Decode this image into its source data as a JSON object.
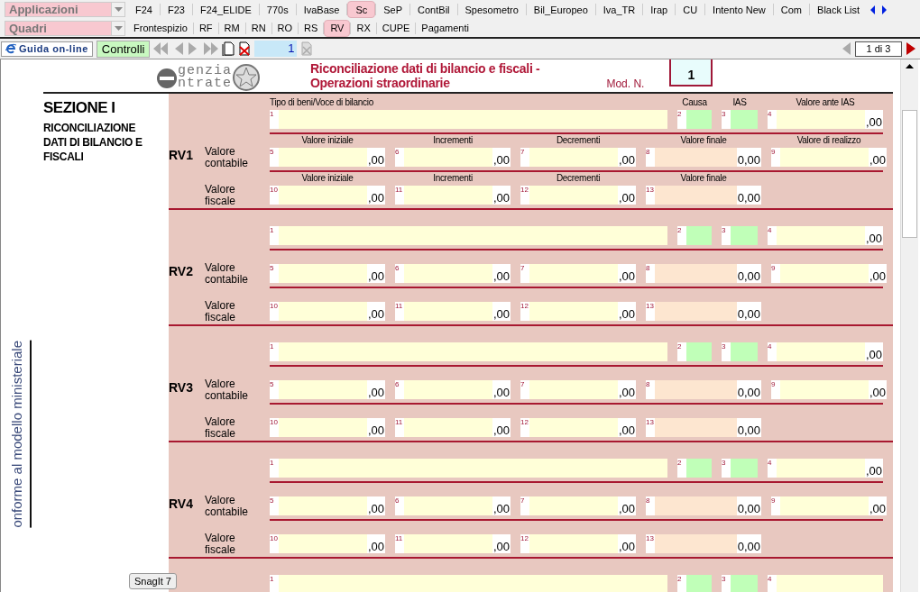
{
  "apps_dropdown": {
    "value": "Applicazioni"
  },
  "quadri_dropdown": {
    "value": "Quadri"
  },
  "app_tabs": [
    {
      "label": "F24",
      "selected": false
    },
    {
      "label": "F23",
      "selected": false
    },
    {
      "label": "F24_ELIDE",
      "selected": false
    },
    {
      "label": "770s",
      "selected": false
    },
    {
      "label": "IvaBase",
      "selected": false
    },
    {
      "label": "Sc",
      "selected": true
    },
    {
      "label": "SeP",
      "selected": false
    },
    {
      "label": "ContBil",
      "selected": false
    },
    {
      "label": "Spesometro",
      "selected": false
    },
    {
      "label": "Bil_Europeo",
      "selected": false
    },
    {
      "label": "Iva_TR",
      "selected": false
    },
    {
      "label": "Irap",
      "selected": false
    },
    {
      "label": "CU",
      "selected": false
    },
    {
      "label": "Intento New",
      "selected": false
    },
    {
      "label": "Com",
      "selected": false
    },
    {
      "label": "Black List",
      "selected": false
    }
  ],
  "quadri_tabs": [
    {
      "label": "Frontespizio",
      "selected": false
    },
    {
      "label": "RF",
      "selected": false
    },
    {
      "label": "RM",
      "selected": false
    },
    {
      "label": "RN",
      "selected": false
    },
    {
      "label": "RO",
      "selected": false
    },
    {
      "label": "RS",
      "selected": false
    },
    {
      "label": "RV",
      "selected": true
    },
    {
      "label": "RX",
      "selected": false
    },
    {
      "label": "CUPE",
      "selected": false
    },
    {
      "label": "Pagamenti",
      "selected": false
    }
  ],
  "toolbar": {
    "guide_button": "Guida on-line",
    "checks_button": "Controlli",
    "page_field": "1",
    "page_counter": "1 di 3"
  },
  "form": {
    "logo_top": "genzia",
    "logo_bottom": "ntrate",
    "title_lines": [
      "Riconciliazione dati di bilancio e fiscali -",
      "Operazioni straordinarie"
    ],
    "mod_label": "Mod. N.",
    "mod_number": "1",
    "section_title": "SEZIONE I",
    "section_subtitle": "RICONCILIAZIONE DATI DI BILANCIO E FISCALI",
    "side_note": "onforme al modello ministeriale",
    "blocks": [
      {
        "code": "RV1",
        "rows": [
          {
            "fields": [
              {
                "num": "1",
                "kind": "text",
                "header": "Tipo di beni/Voce di bilancio"
              },
              {
                "num": "2",
                "kind": "code",
                "header": "Causa"
              },
              {
                "num": "3",
                "kind": "code",
                "header": "IAS"
              },
              {
                "num": "4",
                "kind": "amount",
                "value": ",00",
                "header": "Valore ante IAS"
              }
            ]
          },
          {
            "label": "Valore contabile",
            "fields": [
              {
                "num": "5",
                "kind": "amount",
                "value": ",00",
                "header": "Valore iniziale"
              },
              {
                "num": "6",
                "kind": "amount",
                "value": ",00",
                "header": "Incrementi"
              },
              {
                "num": "7",
                "kind": "amount",
                "value": ",00",
                "header": "Decrementi"
              },
              {
                "num": "8",
                "kind": "computed",
                "value": "0,00",
                "header": "Valore finale"
              },
              {
                "num": "9",
                "kind": "amount",
                "value": ",00",
                "header": "Valore di realizzo"
              }
            ]
          },
          {
            "label": "Valore fiscale",
            "fields": [
              {
                "num": "10",
                "kind": "amount",
                "value": ",00",
                "header": "Valore iniziale"
              },
              {
                "num": "11",
                "kind": "amount",
                "value": ",00",
                "header": "Incrementi"
              },
              {
                "num": "12",
                "kind": "amount",
                "value": ",00",
                "header": "Decrementi"
              },
              {
                "num": "13",
                "kind": "computed",
                "value": "0,00",
                "header": "Valore finale"
              }
            ]
          }
        ]
      },
      {
        "code": "RV2",
        "rows": [
          {
            "fields": [
              {
                "num": "1",
                "kind": "text"
              },
              {
                "num": "2",
                "kind": "code"
              },
              {
                "num": "3",
                "kind": "code"
              },
              {
                "num": "4",
                "kind": "amount",
                "value": ",00"
              }
            ]
          },
          {
            "label": "Valore contabile",
            "fields": [
              {
                "num": "5",
                "kind": "amount",
                "value": ",00"
              },
              {
                "num": "6",
                "kind": "amount",
                "value": ",00"
              },
              {
                "num": "7",
                "kind": "amount",
                "value": ",00"
              },
              {
                "num": "8",
                "kind": "computed",
                "value": "0,00"
              },
              {
                "num": "9",
                "kind": "amount",
                "value": ",00"
              }
            ]
          },
          {
            "label": "Valore fiscale",
            "fields": [
              {
                "num": "10",
                "kind": "amount",
                "value": ",00"
              },
              {
                "num": "11",
                "kind": "amount",
                "value": ",00"
              },
              {
                "num": "12",
                "kind": "amount",
                "value": ",00"
              },
              {
                "num": "13",
                "kind": "computed",
                "value": "0,00"
              }
            ]
          }
        ]
      },
      {
        "code": "RV3",
        "rows": [
          {
            "fields": [
              {
                "num": "1",
                "kind": "text"
              },
              {
                "num": "2",
                "kind": "code"
              },
              {
                "num": "3",
                "kind": "code"
              },
              {
                "num": "4",
                "kind": "amount",
                "value": ",00"
              }
            ]
          },
          {
            "label": "Valore contabile",
            "fields": [
              {
                "num": "5",
                "kind": "amount",
                "value": ",00"
              },
              {
                "num": "6",
                "kind": "amount",
                "value": ",00"
              },
              {
                "num": "7",
                "kind": "amount",
                "value": ",00"
              },
              {
                "num": "8",
                "kind": "computed",
                "value": "0,00"
              },
              {
                "num": "9",
                "kind": "amount",
                "value": ",00"
              }
            ]
          },
          {
            "label": "Valore fiscale",
            "fields": [
              {
                "num": "10",
                "kind": "amount",
                "value": ",00"
              },
              {
                "num": "11",
                "kind": "amount",
                "value": ",00"
              },
              {
                "num": "12",
                "kind": "amount",
                "value": ",00"
              },
              {
                "num": "13",
                "kind": "computed",
                "value": "0,00"
              }
            ]
          }
        ]
      },
      {
        "code": "RV4",
        "rows": [
          {
            "fields": [
              {
                "num": "1",
                "kind": "text"
              },
              {
                "num": "2",
                "kind": "code"
              },
              {
                "num": "3",
                "kind": "code"
              },
              {
                "num": "4",
                "kind": "amount",
                "value": ",00"
              }
            ]
          },
          {
            "label": "Valore contabile",
            "fields": [
              {
                "num": "5",
                "kind": "amount",
                "value": ",00"
              },
              {
                "num": "6",
                "kind": "amount",
                "value": ",00"
              },
              {
                "num": "7",
                "kind": "amount",
                "value": ",00"
              },
              {
                "num": "8",
                "kind": "computed",
                "value": "0,00"
              },
              {
                "num": "9",
                "kind": "amount",
                "value": ",00"
              }
            ]
          },
          {
            "label": "Valore fiscale",
            "fields": [
              {
                "num": "10",
                "kind": "amount",
                "value": ",00"
              },
              {
                "num": "11",
                "kind": "amount",
                "value": ",00"
              },
              {
                "num": "12",
                "kind": "amount",
                "value": ",00"
              },
              {
                "num": "13",
                "kind": "computed",
                "value": "0,00"
              }
            ]
          }
        ]
      },
      {
        "rows": [
          {
            "fields": [
              {
                "num": "1",
                "kind": "text"
              },
              {
                "num": "2",
                "kind": "code"
              },
              {
                "num": "3",
                "kind": "code"
              },
              {
                "num": "4",
                "kind": "amount"
              }
            ]
          }
        ]
      }
    ]
  },
  "tooltip": "SnagIt 7"
}
